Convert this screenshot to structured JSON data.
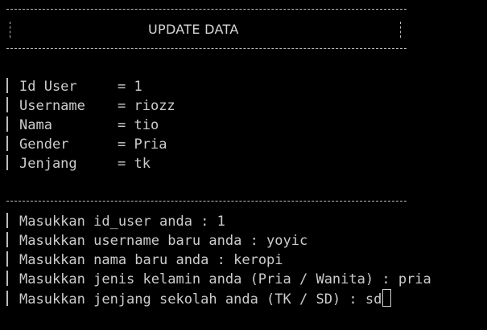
{
  "header": {
    "title": "UPDATE DATA"
  },
  "info": [
    {
      "label": "Id User",
      "sep": "= ",
      "value": "1"
    },
    {
      "label": "Username",
      "sep": "= ",
      "value": "riozz"
    },
    {
      "label": "Nama",
      "sep": "= ",
      "value": "tio"
    },
    {
      "label": "Gender",
      "sep": "= ",
      "value": "Pria"
    },
    {
      "label": "Jenjang",
      "sep": "= ",
      "value": "tk"
    }
  ],
  "prompts": [
    {
      "text": "Masukkan id_user anda : ",
      "input": "1"
    },
    {
      "text": "Masukkan username baru anda : ",
      "input": "yoyic"
    },
    {
      "text": "Masukkan nama baru anda : ",
      "input": "keropi"
    },
    {
      "text": "Masukkan jenis kelamin anda (Pria / Wanita) : ",
      "input": "pria"
    },
    {
      "text": "Masukkan jenjang sekolah anda (TK / SD) : ",
      "input": "sd"
    }
  ]
}
